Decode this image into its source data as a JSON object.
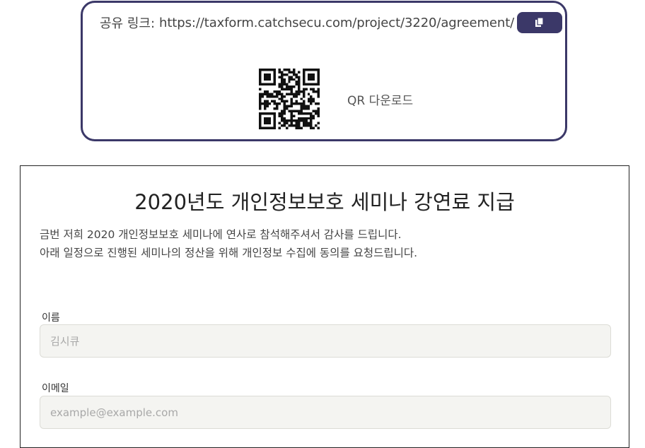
{
  "share": {
    "label": "공유 링크:",
    "url": "https://taxform.catchsecu.com/project/3220/agreement/",
    "copy_icon": "copy-icon",
    "qr_download_label": "QR 다운로드"
  },
  "form": {
    "title": "2020년도 개인정보보호 세미나 강연료 지급",
    "description_lines": [
      "금번 저희 2020 개인정보보호 세미나에 연사로 참석해주셔서 감사를 드립니다.",
      "아래 일정으로 진행된 세미나의 정산을 위해 개인정보 수집에 동의를 요청드립니다."
    ],
    "fields": [
      {
        "label": "이름",
        "value": "",
        "placeholder": "김시큐"
      },
      {
        "label": "이메일",
        "value": "",
        "placeholder": "example@example.com"
      }
    ]
  },
  "colors": {
    "accent": "#3b3868",
    "input_bg": "#f4f4f1"
  }
}
